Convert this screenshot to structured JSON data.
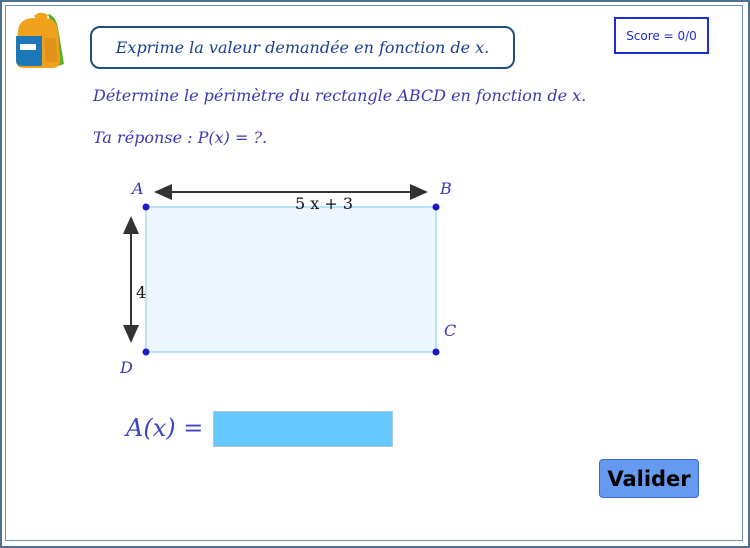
{
  "header": {
    "instruction": "Exprime la valeur demandée en fonction de x.",
    "score_label": "Score = 0/0"
  },
  "question": {
    "text": "Détermine le périmètre du rectangle ABCD en fonction de x.",
    "answer_prompt": "Ta réponse : P(x) = ?."
  },
  "figure": {
    "vertices": {
      "A": "A",
      "B": "B",
      "C": "C",
      "D": "D"
    },
    "length_label": "5 x + 3",
    "width_label": "4",
    "fill_color": "#eef7ff",
    "edge_color": "#7ecbef",
    "point_color": "#1a1ac8"
  },
  "answer": {
    "label": "A(x) =",
    "value": "",
    "placeholder": ""
  },
  "actions": {
    "validate_label": "Valider"
  },
  "icons": {
    "app_logo": "backpack-icon"
  }
}
